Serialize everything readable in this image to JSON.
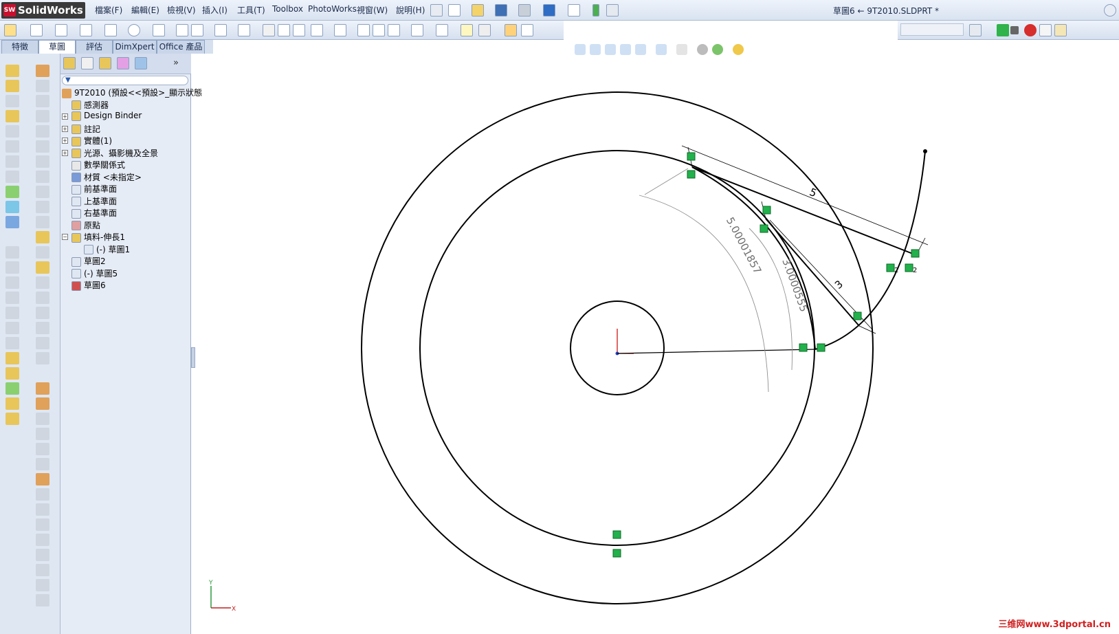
{
  "app": {
    "name": "SolidWorks",
    "logo_mark": "SW"
  },
  "menu": [
    "檔案(F)",
    "編輯(E)",
    "檢視(V)",
    "插入(I)",
    "工具(T)",
    "Toolbox",
    "PhotoWorks",
    "視窗(W)",
    "說明(H)"
  ],
  "window_title": "草圖6 ← 9T2010.SLDPRT *",
  "tabs": [
    "特徵",
    "草圖",
    "評估",
    "DimXpert",
    "Office 產品"
  ],
  "active_tab": "草圖",
  "tree": {
    "root": "9T2010 (預設<<預設>_顯示狀態",
    "items": [
      {
        "label": "感測器",
        "icon": "sensor-icon",
        "expandable": false
      },
      {
        "label": "Design Binder",
        "icon": "binder-icon",
        "expandable": true
      },
      {
        "label": "註記",
        "icon": "annotation-icon",
        "expandable": true
      },
      {
        "label": "實體(1)",
        "icon": "solid-body-icon",
        "expandable": true
      },
      {
        "label": "光源、攝影機及全景",
        "icon": "lights-icon",
        "expandable": true
      },
      {
        "label": "數學關係式",
        "icon": "equation-icon",
        "expandable": false
      },
      {
        "label": "材質 <未指定>",
        "icon": "material-icon",
        "expandable": false
      },
      {
        "label": "前基準面",
        "icon": "plane-icon",
        "expandable": false
      },
      {
        "label": "上基準面",
        "icon": "plane-icon",
        "expandable": false
      },
      {
        "label": "右基準面",
        "icon": "plane-icon",
        "expandable": false
      },
      {
        "label": "原點",
        "icon": "origin-icon",
        "expandable": false
      },
      {
        "label": "填料-伸長1",
        "icon": "extrude-icon",
        "expandable": true,
        "expanded": true
      },
      {
        "label": "(-) 草圖1",
        "icon": "sketch-icon",
        "child": true
      },
      {
        "label": "草圖2",
        "icon": "sketch-icon",
        "expandable": false
      },
      {
        "label": "(-) 草圖5",
        "icon": "sketch-icon",
        "expandable": false
      },
      {
        "label": "草圖6",
        "icon": "sketch-active-icon",
        "expandable": false
      }
    ]
  },
  "sketch": {
    "dim_linear_1": "5",
    "dim_linear_2": "3",
    "dim_arc_1": "5.00001857",
    "dim_arc_2": "3.0000555",
    "relation_tag": "2",
    "axis_y": "Y",
    "axis_x": "X"
  },
  "watermark": "三维网www.3dportal.cn",
  "colors": {
    "accent": "#d02020",
    "relation": "#22b14c",
    "sketch_line": "#000000",
    "dim": "#808080"
  }
}
